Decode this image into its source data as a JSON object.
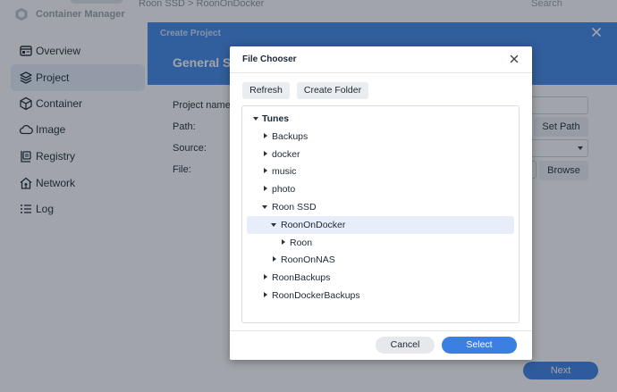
{
  "app": {
    "title": "Container Manager",
    "breadcrumb": "Roon SSD > RoonOnDocker",
    "search_placeholder": "Search"
  },
  "sidebar": {
    "items": [
      {
        "label": "Overview",
        "icon": "overview-icon"
      },
      {
        "label": "Project",
        "icon": "project-icon",
        "active": true
      },
      {
        "label": "Container",
        "icon": "container-icon"
      },
      {
        "label": "Image",
        "icon": "image-cloud-icon"
      },
      {
        "label": "Registry",
        "icon": "registry-icon"
      },
      {
        "label": "Network",
        "icon": "network-icon"
      },
      {
        "label": "Log",
        "icon": "log-icon"
      }
    ]
  },
  "create_project": {
    "title": "Create Project",
    "subtitle": "General Se",
    "fields": {
      "project_name": "Project name:",
      "path": "Path:",
      "source": "Source:",
      "file": "File:"
    },
    "set_path_label": "Set Path",
    "browse_label": "Browse",
    "next_label": "Next"
  },
  "file_chooser": {
    "title": "File Chooser",
    "refresh_label": "Refresh",
    "create_folder_label": "Create Folder",
    "tree": [
      {
        "label": "Tunes",
        "level": 0,
        "expanded": true,
        "root": true
      },
      {
        "label": "Backups",
        "level": 1,
        "expanded": false
      },
      {
        "label": "docker",
        "level": 1,
        "expanded": false
      },
      {
        "label": "music",
        "level": 1,
        "expanded": false
      },
      {
        "label": "photo",
        "level": 1,
        "expanded": false
      },
      {
        "label": "Roon SSD",
        "level": 1,
        "expanded": true
      },
      {
        "label": "RoonOnDocker",
        "level": 2,
        "expanded": true,
        "selected": true
      },
      {
        "label": "Roon",
        "level": 3,
        "expanded": false
      },
      {
        "label": "RoonOnNAS",
        "level": 2,
        "expanded": false
      },
      {
        "label": "RoonBackups",
        "level": 1,
        "expanded": false
      },
      {
        "label": "RoonDockerBackups",
        "level": 1,
        "expanded": false
      }
    ],
    "cancel_label": "Cancel",
    "select_label": "Select"
  },
  "colors": {
    "accent": "#3b7fe3",
    "header_blue": "#3f86e6",
    "selected_row": "#e8eef9",
    "sidebar_active": "#e6eef9"
  }
}
